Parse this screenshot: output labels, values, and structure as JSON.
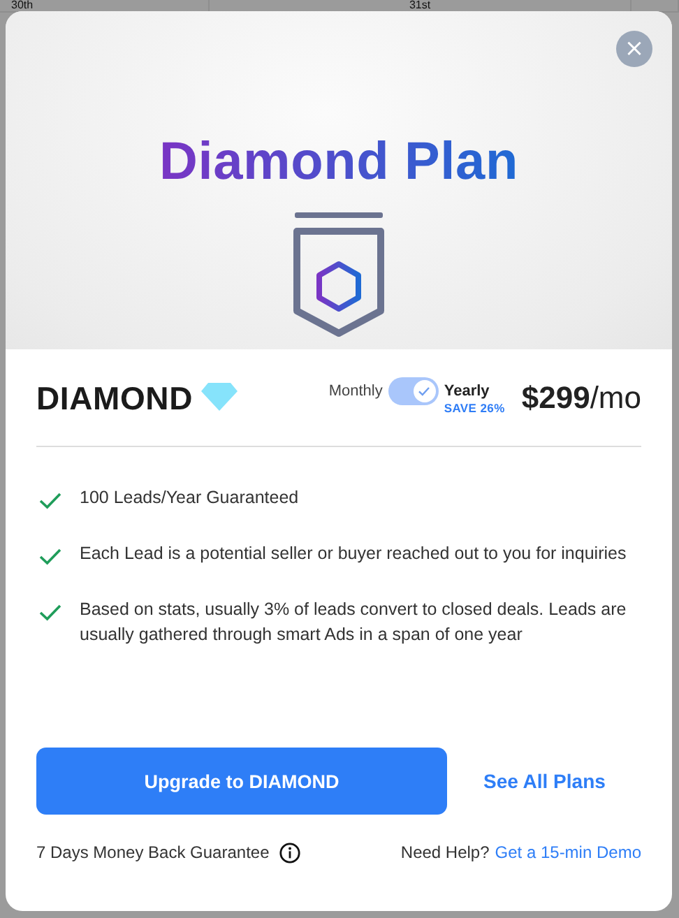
{
  "backdrop": {
    "columns": [
      "30th",
      "31st"
    ]
  },
  "modal": {
    "title": "Diamond Plan",
    "close": "×",
    "plan": {
      "name": "DIAMOND",
      "toggle": {
        "left_label": "Monthly",
        "right_label": "Yearly",
        "on": true,
        "note": "SAVE 26%"
      },
      "price": "**$299**/mo"
    },
    "features": [
      {
        "text": "100 Leads/Year Guaranteed",
        "checked": true
      },
      {
        "text": "Each Lead is a potential seller or buyer reached out to you for inquiries",
        "checked": true
      },
      {
        "text": "Based on stats, usually 3% of leads convert to closed deals. Leads are usually gathered through smart Ads in a span of one year",
        "checked": true
      }
    ],
    "primary_button": "Upgrade to DIAMOND",
    "secondary_link": "See All Plans",
    "guarantee": "7 Days Money Back Guarantee",
    "help": {
      "label": "Need Help?",
      "link": "Get a 15-min Demo"
    }
  }
}
